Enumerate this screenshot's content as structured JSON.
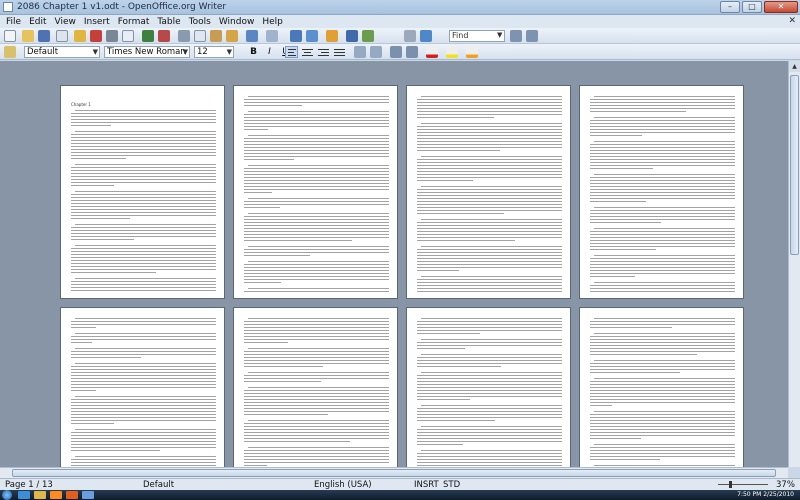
{
  "window": {
    "title": "2086 Chapter 1 v1.odt - OpenOffice.org Writer",
    "minimize_symbol": "–",
    "maximize_symbol": "□",
    "close_symbol": "✕"
  },
  "menubar": {
    "items": [
      "File",
      "Edit",
      "View",
      "Insert",
      "Format",
      "Table",
      "Tools",
      "Window",
      "Help"
    ],
    "close_doc_symbol": "✕"
  },
  "find_toolbar": {
    "value": "Find"
  },
  "format_toolbar": {
    "paragraph_style": "Default",
    "font_name": "Times New Roman",
    "font_size": "12",
    "bold_label": "B",
    "italic_label": "I",
    "underline_label": "U"
  },
  "document": {
    "first_page_heading": "Chapter 1",
    "page_count_visible": 8
  },
  "statusbar": {
    "page": "Page 1 / 13",
    "page_style": "Default",
    "language": "English (USA)",
    "insert_mode": "INSRT",
    "selection_mode": "STD",
    "zoom": "37%"
  },
  "taskbar": {
    "time": "7:50 PM",
    "date": "2/25/2010"
  },
  "colors": {
    "workspace_bg": "#8795a6",
    "toolbar_bg": "#e1e9f3",
    "close_button": "#c24a34"
  },
  "icons": {
    "toolbar1": [
      "new-document-icon",
      "open-icon",
      "save-icon",
      "email-icon",
      "edit-file-icon",
      "export-pdf-icon",
      "print-icon",
      "page-preview-icon",
      "spellcheck-icon",
      "autospellcheck-icon",
      "cut-icon",
      "copy-icon",
      "paste-icon",
      "format-paintbrush-icon",
      "undo-icon",
      "redo-icon",
      "hyperlink-icon",
      "table-icon",
      "draw-functions-icon",
      "navigator-icon",
      "gallery-icon",
      "zoom-icon",
      "help-icon"
    ],
    "toolbar2": [
      "styles-icon",
      "bold-icon",
      "italic-icon",
      "underline-icon",
      "align-left-icon",
      "align-center-icon",
      "align-right-icon",
      "justify-icon",
      "numbering-icon",
      "bullets-icon",
      "decrease-indent-icon",
      "increase-indent-icon",
      "font-color-icon",
      "highlight-icon",
      "background-color-icon"
    ]
  }
}
